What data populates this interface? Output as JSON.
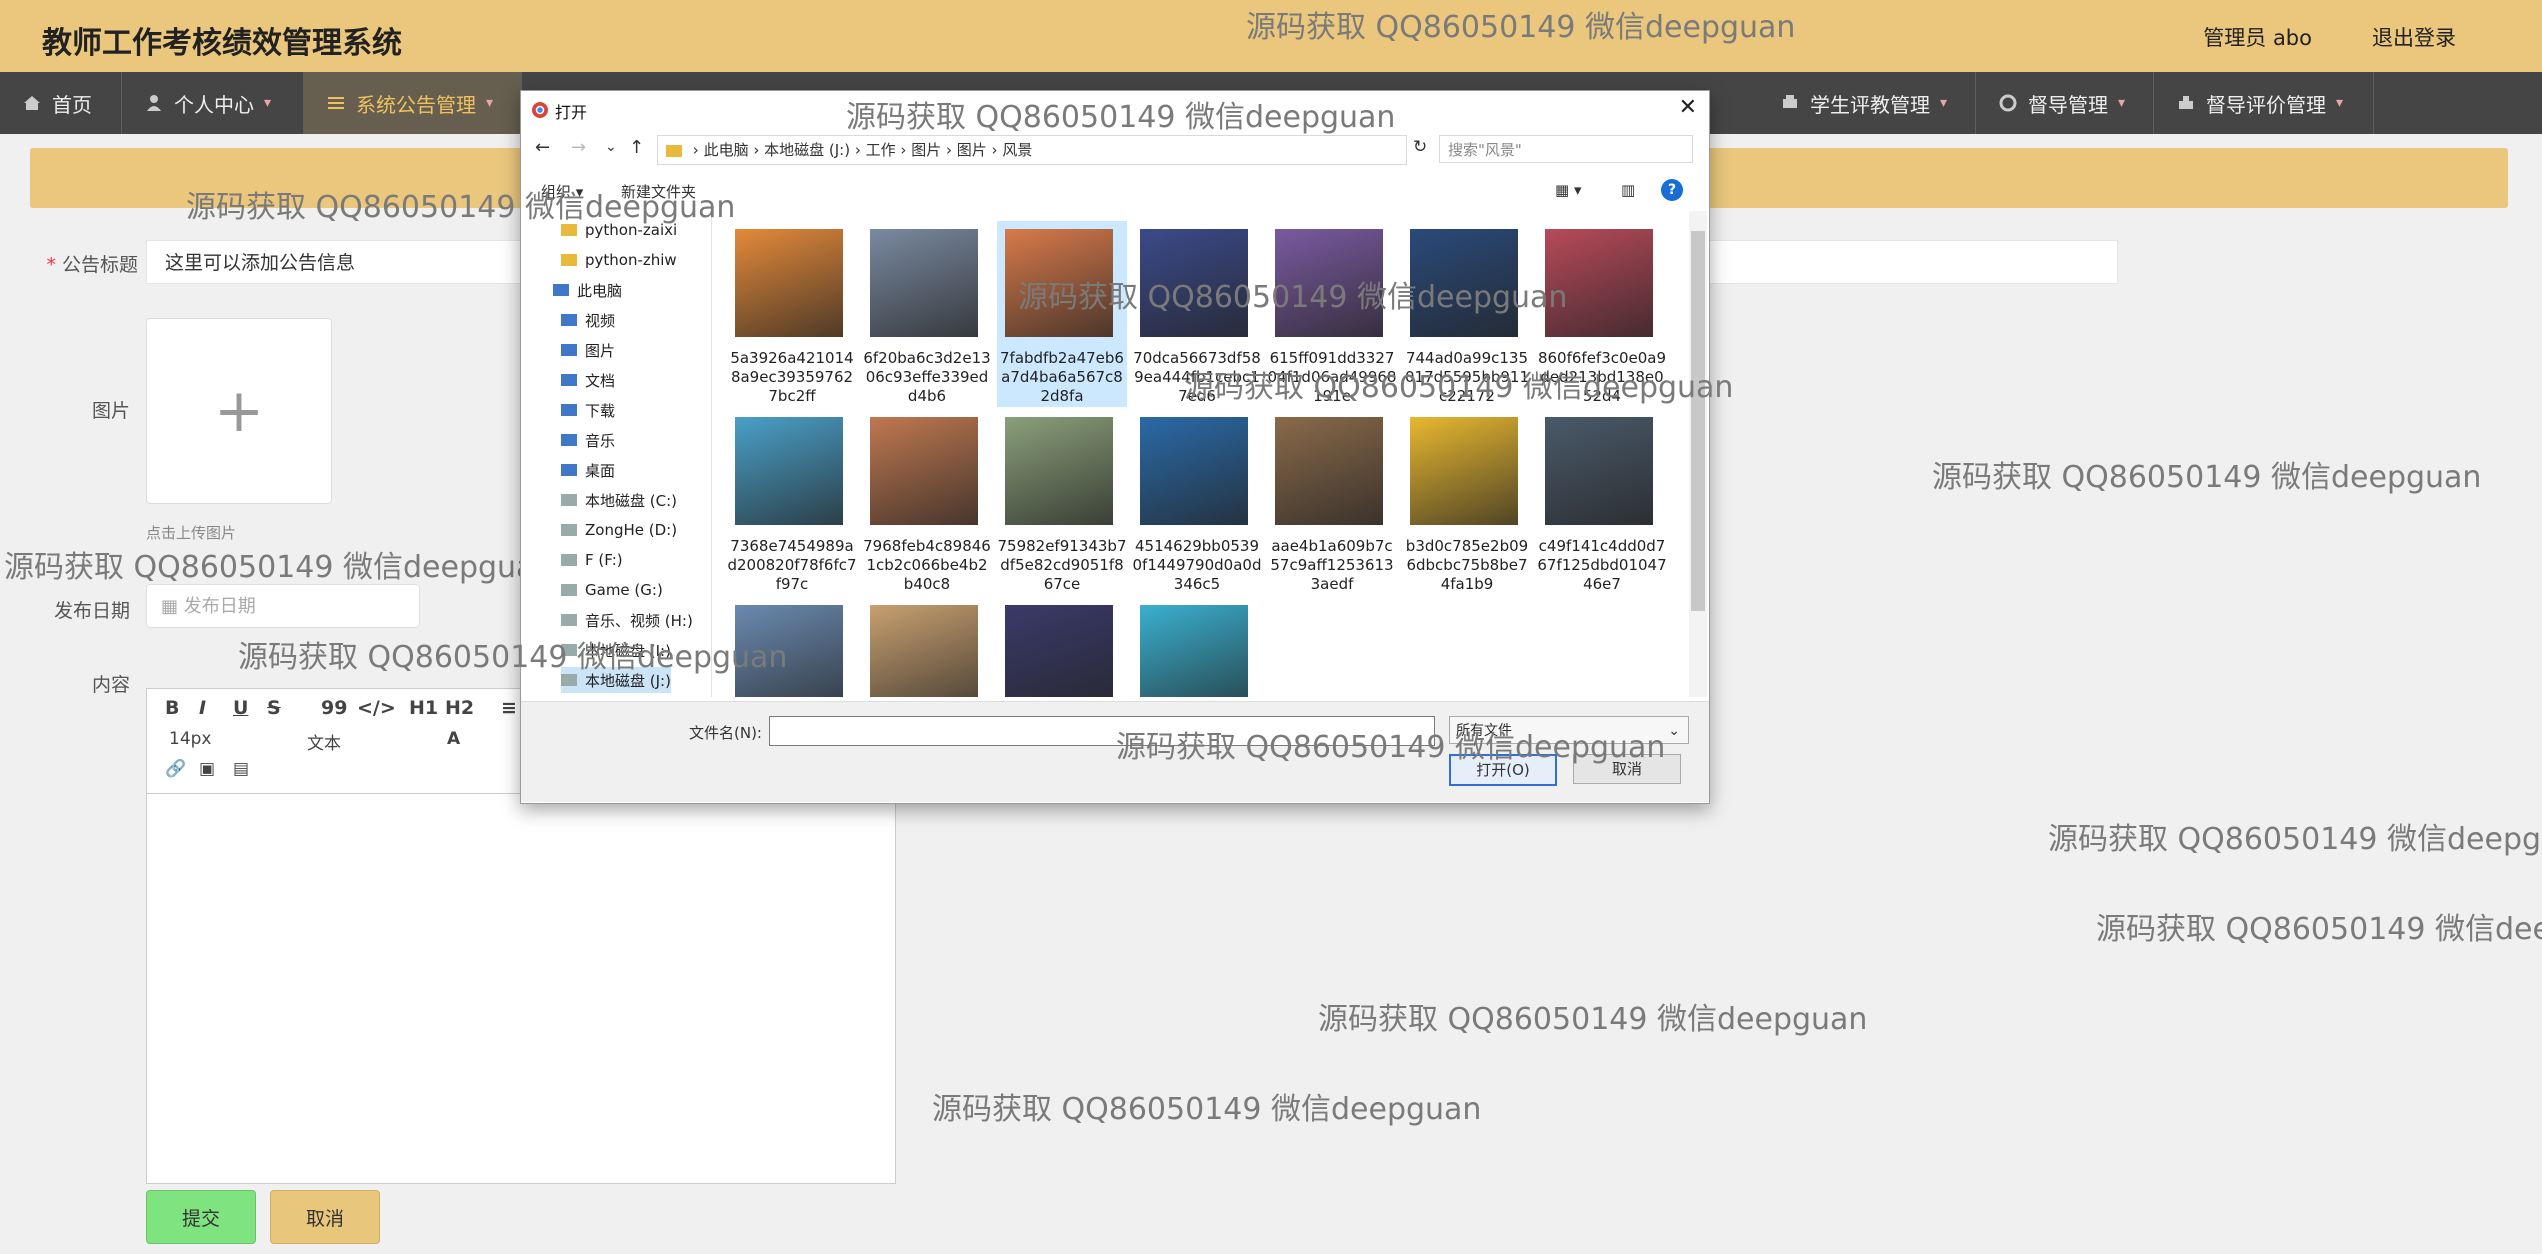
{
  "header": {
    "title": "教师工作考核绩效管理系统",
    "user": "管理员 abo",
    "logout": "退出登录"
  },
  "nav": [
    {
      "label": "首页",
      "icon": "home-icon"
    },
    {
      "label": "个人中心",
      "icon": "user-icon"
    },
    {
      "label": "系统公告管理",
      "icon": "sliders-icon",
      "active": true
    },
    {
      "label": "学生评教管理",
      "icon": "print-icon"
    },
    {
      "label": "督导管理",
      "icon": "gear-icon"
    },
    {
      "label": "督导评价管理",
      "icon": "stamp-icon"
    }
  ],
  "form": {
    "title_label": "公告标题",
    "title_required_mark": "*",
    "title_value": "这里可以添加公告信息",
    "image_label": "图片",
    "upload_hint": "点击上传图片",
    "date_label": "发布日期",
    "date_placeholder": "发布日期",
    "content_label": "内容",
    "submit": "提交",
    "cancel": "取消"
  },
  "editor": {
    "font_size": "14px",
    "paragraph": "文本",
    "buttons": [
      "B",
      "I",
      "U",
      "S",
      "99",
      "</>",
      "H1",
      "H2",
      "≡"
    ]
  },
  "dialog": {
    "title": "打开",
    "path": [
      "此电脑",
      "本地磁盘 (J:)",
      "工作",
      "图片",
      "图片",
      "风景"
    ],
    "search_placeholder": "搜索\"风景\"",
    "organize": "组织 ▾",
    "new_folder": "新建文件夹",
    "filename_label": "文件名(N):",
    "filetype": "所有文件",
    "open": "打开(O)",
    "cancel": "取消",
    "tree": [
      {
        "label": "python-zaixi",
        "icon": "folder-icon"
      },
      {
        "label": "python-zhiw",
        "icon": "folder-icon"
      },
      {
        "label": "此电脑",
        "icon": "computer-icon"
      },
      {
        "label": "视频",
        "icon": "video-icon"
      },
      {
        "label": "图片",
        "icon": "picture-icon"
      },
      {
        "label": "文档",
        "icon": "document-icon"
      },
      {
        "label": "下载",
        "icon": "download-icon"
      },
      {
        "label": "音乐",
        "icon": "music-icon"
      },
      {
        "label": "桌面",
        "icon": "desktop-icon"
      },
      {
        "label": "本地磁盘 (C:)",
        "icon": "drive-icon"
      },
      {
        "label": "ZongHe (D:)",
        "icon": "drive-icon"
      },
      {
        "label": "F (F:)",
        "icon": "drive-icon"
      },
      {
        "label": "Game (G:)",
        "icon": "drive-icon"
      },
      {
        "label": "音乐、视频 (H:)",
        "icon": "drive-icon"
      },
      {
        "label": "本地磁盘 (I:)",
        "icon": "drive-icon"
      },
      {
        "label": "本地磁盘 (J:)",
        "icon": "drive-icon"
      }
    ],
    "files": [
      {
        "name": "5a3926a4210148a9ec393597627bc2ff",
        "color": "#e48a3a"
      },
      {
        "name": "6f20ba6c3d2e1306c93effe339edd4b6",
        "color": "#7a8aa0"
      },
      {
        "name": "7fabdfb2a47eb6a7d4ba6a567c82d8fa",
        "color": "#d87a4a",
        "selected": true
      },
      {
        "name": "70dca56673df589ea444fb1cebc17ed6",
        "color": "#3b4a8a"
      },
      {
        "name": "615ff091dd332704f1d06ad49968191e",
        "color": "#7a5aa0"
      },
      {
        "name": "744ad0a99c135017d5595bb911c22172",
        "color": "#2a4a7a"
      },
      {
        "name": "860f6fef3c0e0a9ded213bd138e052d4",
        "color": "#b84a5a"
      },
      {
        "name": "7368e7454989ad200820f78f6fc7f97c",
        "color": "#4aa0c8"
      },
      {
        "name": "7968feb4c898461cb2c066be4b2b40c8",
        "color": "#c07850"
      },
      {
        "name": "75982ef91343b7df5e82cd9051f867ce",
        "color": "#8aa07a"
      },
      {
        "name": "4514629bb05390f1449790d0a0d346c5",
        "color": "#2a6aa8"
      },
      {
        "name": "aae4b1a609b7c57c9aff12536133aedf",
        "color": "#8a6a4a"
      },
      {
        "name": "b3d0c785e2b096dbcbc75b8be74fa1b9",
        "color": "#e8b830"
      },
      {
        "name": "c49f141c4dd0d767f125dbd0104746e7",
        "color": "#4a5a6a"
      },
      {
        "name": "",
        "color": "#6a8ab0"
      },
      {
        "name": "",
        "color": "#c8a070"
      },
      {
        "name": "",
        "color": "#3a3a6a"
      },
      {
        "name": "",
        "color": "#3ab0d0"
      }
    ]
  },
  "watermark": "源码获取 QQ86050149 微信deepguan"
}
